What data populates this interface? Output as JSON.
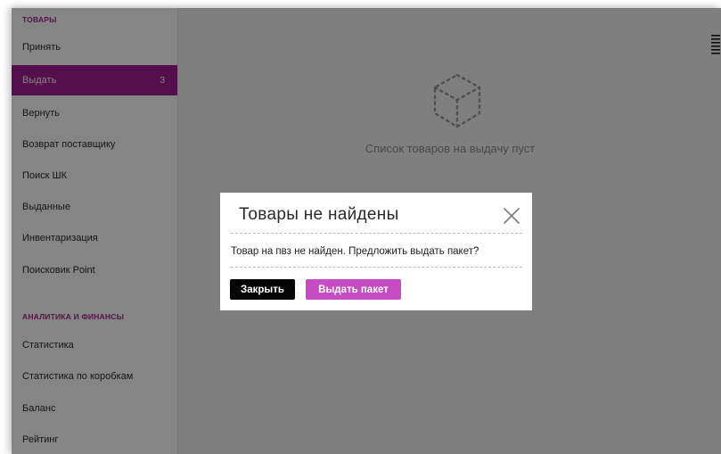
{
  "sidebar": {
    "section_goods": "ТОВАРЫ",
    "items_goods": [
      {
        "label": "Принять"
      },
      {
        "label": "Выдать",
        "count": "3"
      },
      {
        "label": "Вернуть"
      },
      {
        "label": "Возврат поставщику"
      },
      {
        "label": "Поиск ШК"
      },
      {
        "label": "Выданные"
      },
      {
        "label": "Инвентаризация"
      },
      {
        "label": "Поисковик Point"
      }
    ],
    "section_analytics": "АНАЛИТИКА И ФИНАНСЫ",
    "items_analytics": [
      {
        "label": "Статистика"
      },
      {
        "label": "Статистика по коробкам"
      },
      {
        "label": "Баланс"
      },
      {
        "label": "Рейтинг"
      }
    ],
    "active_item": "Выдать"
  },
  "main": {
    "empty_icon": "box-outline-icon",
    "empty_text": "Список товаров на выдачу пуст",
    "menu_icon": "menu-icon"
  },
  "modal": {
    "title": "Товары не найдены",
    "message": "Товар на пвз не найден. Предложить выдать пакет?",
    "close_label": "Закрыть",
    "issue_label": "Выдать пакет",
    "close_icon": "close-icon"
  },
  "colors": {
    "accent": "#a61e95",
    "section_title": "#a4288f",
    "issue_button": "#c64cc3",
    "close_button": "#050505",
    "overlay": "rgba(0,0,0,0.48)"
  }
}
